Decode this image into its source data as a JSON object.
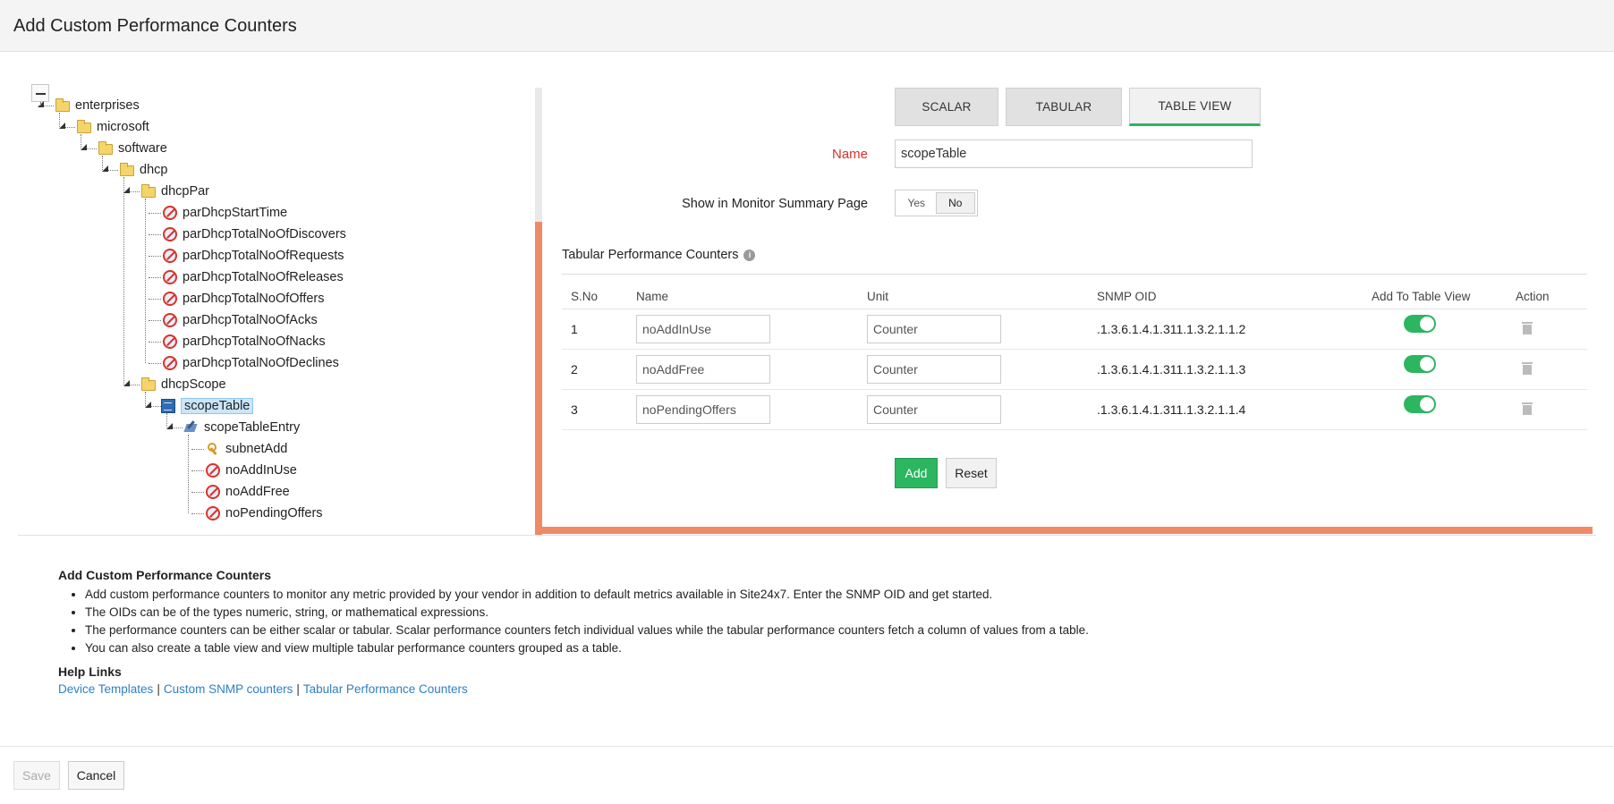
{
  "header": {
    "title": "Add Custom Performance Counters"
  },
  "tree": {
    "nodes": [
      {
        "label": "enterprises",
        "icon": "folder-icon"
      },
      {
        "label": "microsoft",
        "icon": "folder-icon"
      },
      {
        "label": "software",
        "icon": "folder-icon"
      },
      {
        "label": "dhcp",
        "icon": "folder-icon"
      },
      {
        "label": "dhcpPar",
        "icon": "folder-icon"
      },
      {
        "label": "parDhcpStartTime",
        "icon": "counter-icon"
      },
      {
        "label": "parDhcpTotalNoOfDiscovers",
        "icon": "counter-icon"
      },
      {
        "label": "parDhcpTotalNoOfRequests",
        "icon": "counter-icon"
      },
      {
        "label": "parDhcpTotalNoOfReleases",
        "icon": "counter-icon"
      },
      {
        "label": "parDhcpTotalNoOfOffers",
        "icon": "counter-icon"
      },
      {
        "label": "parDhcpTotalNoOfAcks",
        "icon": "counter-icon"
      },
      {
        "label": "parDhcpTotalNoOfNacks",
        "icon": "counter-icon"
      },
      {
        "label": "parDhcpTotalNoOfDeclines",
        "icon": "counter-icon"
      },
      {
        "label": "dhcpScope",
        "icon": "folder-icon"
      },
      {
        "label": "scopeTable",
        "icon": "table-icon",
        "selected": true
      },
      {
        "label": "scopeTableEntry",
        "icon": "table-entry-icon"
      },
      {
        "label": "subnetAdd",
        "icon": "key-icon"
      },
      {
        "label": "noAddInUse",
        "icon": "counter-icon"
      },
      {
        "label": "noAddFree",
        "icon": "counter-icon"
      },
      {
        "label": "noPendingOffers",
        "icon": "counter-icon"
      }
    ]
  },
  "tabs": [
    {
      "label": "SCALAR",
      "active": false
    },
    {
      "label": "TABULAR",
      "active": false
    },
    {
      "label": "TABLE VIEW",
      "active": true
    }
  ],
  "form": {
    "name_label": "Name",
    "name_value": "scopeTable",
    "summary_label": "Show in Monitor Summary Page",
    "yes": "Yes",
    "no": "No",
    "selected_option": "No"
  },
  "counters": {
    "title": "Tabular Performance Counters",
    "info_icon": "info-icon",
    "headers": {
      "sno": "S.No",
      "name": "Name",
      "unit": "Unit",
      "oid": "SNMP OID",
      "add_to_view": "Add To Table View",
      "action": "Action"
    },
    "rows": [
      {
        "sno": "1",
        "name": "noAddInUse",
        "unit": "Counter",
        "oid": ".1.3.6.1.4.1.311.1.3.2.1.1.2",
        "enabled": true
      },
      {
        "sno": "2",
        "name": "noAddFree",
        "unit": "Counter",
        "oid": ".1.3.6.1.4.1.311.1.3.2.1.1.3",
        "enabled": true
      },
      {
        "sno": "3",
        "name": "noPendingOffers",
        "unit": "Counter",
        "oid": ".1.3.6.1.4.1.311.1.3.2.1.1.4",
        "enabled": true
      }
    ],
    "add_label": "Add",
    "reset_label": "Reset"
  },
  "help": {
    "title": "Add Custom Performance Counters",
    "bullets": [
      "Add custom performance counters to monitor any metric provided by your vendor in addition to default metrics available in Site24x7. Enter the SNMP OID and get started.",
      "The OIDs can be of the types numeric, string, or mathematical expressions.",
      "The performance counters can be either scalar or tabular. Scalar performance counters fetch individual values while the tabular performance counters fetch a column of values from a table.",
      "You can also create a table view and view multiple tabular performance counters grouped as a table."
    ],
    "links_title": "Help Links",
    "links": [
      "Device Templates",
      "Custom SNMP counters",
      "Tabular Performance Counters"
    ],
    "separator": "|"
  },
  "footer": {
    "save_label": "Save",
    "cancel_label": "Cancel"
  },
  "colors": {
    "accent": "#2bb65f",
    "panel_border": "#ee8b66",
    "required": "#d9322b",
    "link": "#2f7fc4"
  }
}
